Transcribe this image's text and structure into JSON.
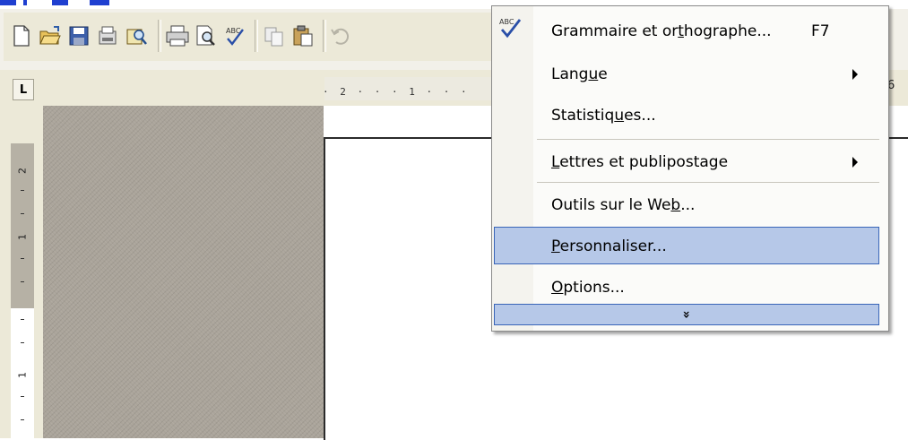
{
  "menu": {
    "items": [
      {
        "label_pre": "Grammaire et or",
        "label_u": "t",
        "label_post": "hographe...",
        "shortcut": "F7",
        "submenu": false
      },
      {
        "label_pre": "Lang",
        "label_u": "u",
        "label_post": "e",
        "shortcut": "",
        "submenu": true
      },
      {
        "label_pre": "Statistiq",
        "label_u": "u",
        "label_post": "es...",
        "shortcut": "",
        "submenu": false
      },
      {
        "label_pre": "",
        "label_u": "L",
        "label_post": "ettres et publipostage",
        "shortcut": "",
        "submenu": true
      },
      {
        "label_pre": "Outils sur le We",
        "label_u": "b",
        "label_post": "...",
        "shortcut": "",
        "submenu": false
      },
      {
        "label_pre": "",
        "label_u": "P",
        "label_post": "ersonnaliser...",
        "shortcut": "",
        "submenu": false,
        "highlighted": true
      },
      {
        "label_pre": "",
        "label_u": "O",
        "label_post": "ptions...",
        "shortcut": "",
        "submenu": false
      }
    ],
    "expand_glyph": "»",
    "abc_label": "ABC"
  },
  "ruler": {
    "corner": "L",
    "h_labels": "· 2 · · · 1 · · ·",
    "right_number": "6",
    "v_labels": [
      "2",
      "1",
      "1"
    ]
  },
  "toolbar": {
    "icons": [
      "new-document-icon",
      "open-folder-icon",
      "save-icon",
      "permission-icon",
      "research-icon",
      "print-icon",
      "print-preview-icon",
      "spelling-icon",
      "copy-icon",
      "paste-icon",
      "undo-icon"
    ]
  },
  "colors": {
    "menu_highlight": "#b6c8e8",
    "menu_highlight_border": "#3965b8",
    "workspace": "#aaa49a",
    "toolbar": "#ece9d8"
  }
}
